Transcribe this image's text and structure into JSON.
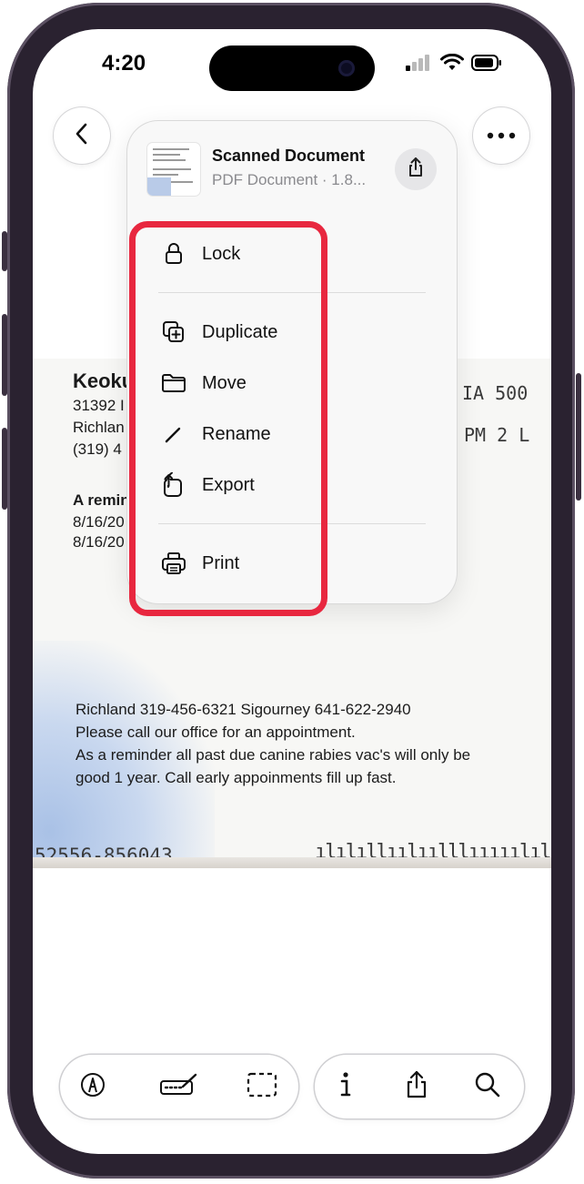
{
  "status_bar": {
    "time": "4:20"
  },
  "document": {
    "title": "Scanned Document",
    "subtitle": "PDF Document · 1.8..."
  },
  "menu": {
    "lock": "Lock",
    "duplicate": "Duplicate",
    "move": "Move",
    "rename": "Rename",
    "export": "Export",
    "print": "Print"
  },
  "scan": {
    "heading": "Keoku",
    "addr1": "31392 I",
    "addr2": "Richlan",
    "phone": "(319) 4",
    "right1": "IA  500",
    "right2": "PM 2  L",
    "reminder": "A remin",
    "date1": "8/16/20",
    "date2": "8/16/20",
    "p1": "Richland 319-456-6321    Sigourney 641-622-2940",
    "p2": "Please call our office for an appointment.",
    "p3": "As a reminder all past due canine rabies vac's will only  be",
    "p4": " good 1 year.  Call early appoinments fill up fast.",
    "barcode_number": "52556-856043",
    "barcode_marks": "ılılıllıılıılllııııılılılıııllılıl"
  },
  "colors": {
    "highlight": "#e8273f"
  },
  "icons": [
    "back-chevron-icon",
    "more-ellipsis-icon",
    "share-icon",
    "lock-icon",
    "duplicate-icon",
    "folder-icon",
    "pencil-icon",
    "export-icon",
    "printer-icon",
    "markup-icon",
    "signature-icon",
    "select-icon",
    "info-icon",
    "search-icon"
  ]
}
